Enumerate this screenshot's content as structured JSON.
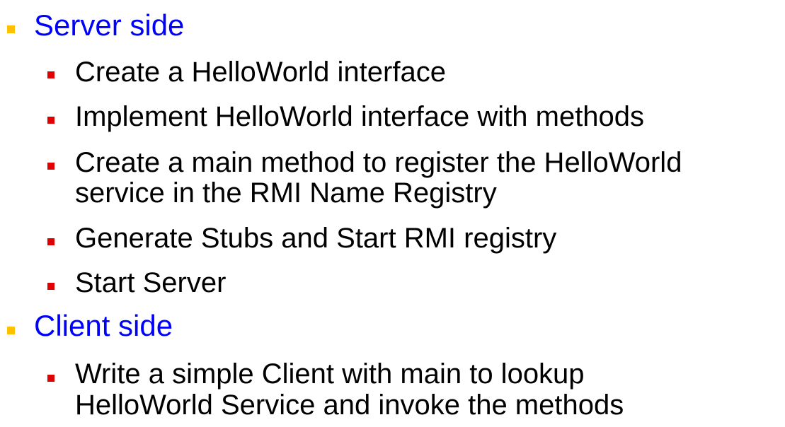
{
  "colors": {
    "section_bullet": "#ffc000",
    "item_bullet": "#e00000",
    "section_title": "#0000ff",
    "item_text": "#000000"
  },
  "sections": [
    {
      "title": "Server side",
      "items": [
        "Create a HelloWorld interface",
        "Implement HelloWorld interface with methods",
        "Create a main method to register the HelloWorld",
        "service in the RMI Name Registry",
        "Generate Stubs and Start RMI registry",
        "Start Server"
      ]
    },
    {
      "title": "Client side",
      "items": [
        "Write a simple Client with main to lookup",
        "HelloWorld Service and invoke the methods"
      ]
    }
  ]
}
